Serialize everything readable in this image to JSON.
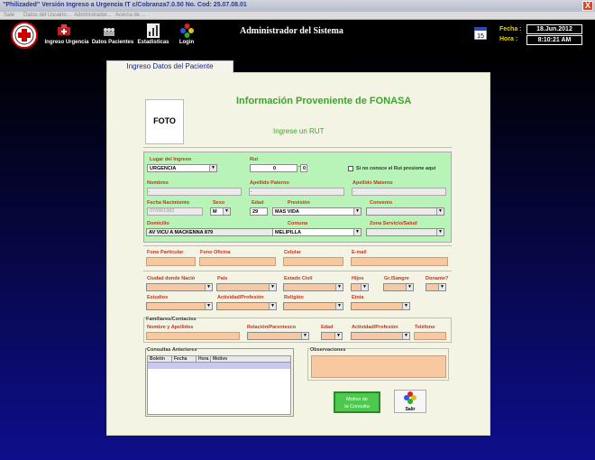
{
  "window": {
    "title": "\"Philizaded\"  Versión Ingreso a Urgencia IT c/Cobranza7.0.50 No. Cod: 25.07.08.01",
    "close": "X"
  },
  "menu": [
    "Sale",
    "Datos del Usuario...",
    "Administrador...",
    "Acerca de ..."
  ],
  "toolbar": {
    "items": [
      "Ingreso Urgencia",
      "Datos Pacientes",
      "Estadisticas",
      "Login"
    ],
    "system_title": "Administrador del Sistema",
    "fecha_label": "Fecha :",
    "fecha_value": "18.Jun.2012",
    "hora_label": "Hora  :",
    "hora_value": "8:10:21 AM"
  },
  "tab": "Ingreso Datos del Paciente",
  "foto": "FOTO",
  "info_title": "Información Proveniente de FONASA",
  "rut_prompt": "Ingrese un RUT",
  "labels": {
    "lugar": "Lugar del Ingreso",
    "rut": "Rut",
    "no_rut": "Si no conoce el Rut presione aquí",
    "nombres": "Nombres",
    "ap_paterno": "Apellido Paterno",
    "ap_materno": "Apellido Materno",
    "fecha_nac": "Fecha Nacimiento",
    "sexo": "Sexo",
    "edad": "Edad",
    "prevision": "Previsión",
    "convenio": "Convenio",
    "domicilio": "Domicilio",
    "comuna": "Comuna",
    "zona": "Zona Servicio/Salud",
    "fono_part": "Fono Particular",
    "fono_of": "Fono Oficina",
    "celular": "Celular",
    "email": "E-mail",
    "ciudad": "Ciudad donde Nació",
    "pais": "País",
    "estado_civil": "Estado Civil",
    "hijos": "Hijos",
    "gr_sangre": "Gr./Sangre",
    "donante": "Donante?",
    "estudios": "Estudios",
    "actividad": "Actividad/Profesión",
    "religion": "Religión",
    "etnia": "Etnia",
    "familiares": "Familiares/Contactos",
    "nombre_ap": "Nombre y Apellidos",
    "relacion": "Relación/Parentesco",
    "f_edad": "Edad",
    "f_actividad": "Actividad/Profesión",
    "telefono": "Teléfono",
    "consultas": "Consultas Anteriores",
    "observaciones": "Observaciones"
  },
  "values": {
    "lugar": "URGENCIA",
    "rut_num": "0",
    "rut_dv": "0",
    "nombres": ".",
    "ap_paterno": ".",
    "ap_materno": ".",
    "fecha_nac": "07/08/1982",
    "sexo": "M",
    "edad": "29",
    "prevision": "MAS VIDA",
    "domicilio": "AV VICU A MACKENNA 879",
    "comuna": "MELIPILLA"
  },
  "consultas_cols": [
    "Boletín",
    "Fecha",
    "Hora",
    "Motivo"
  ],
  "buttons": {
    "motivo_line1": "Motivo de",
    "motivo_line2": "la Consulta",
    "salir": "Salir"
  }
}
